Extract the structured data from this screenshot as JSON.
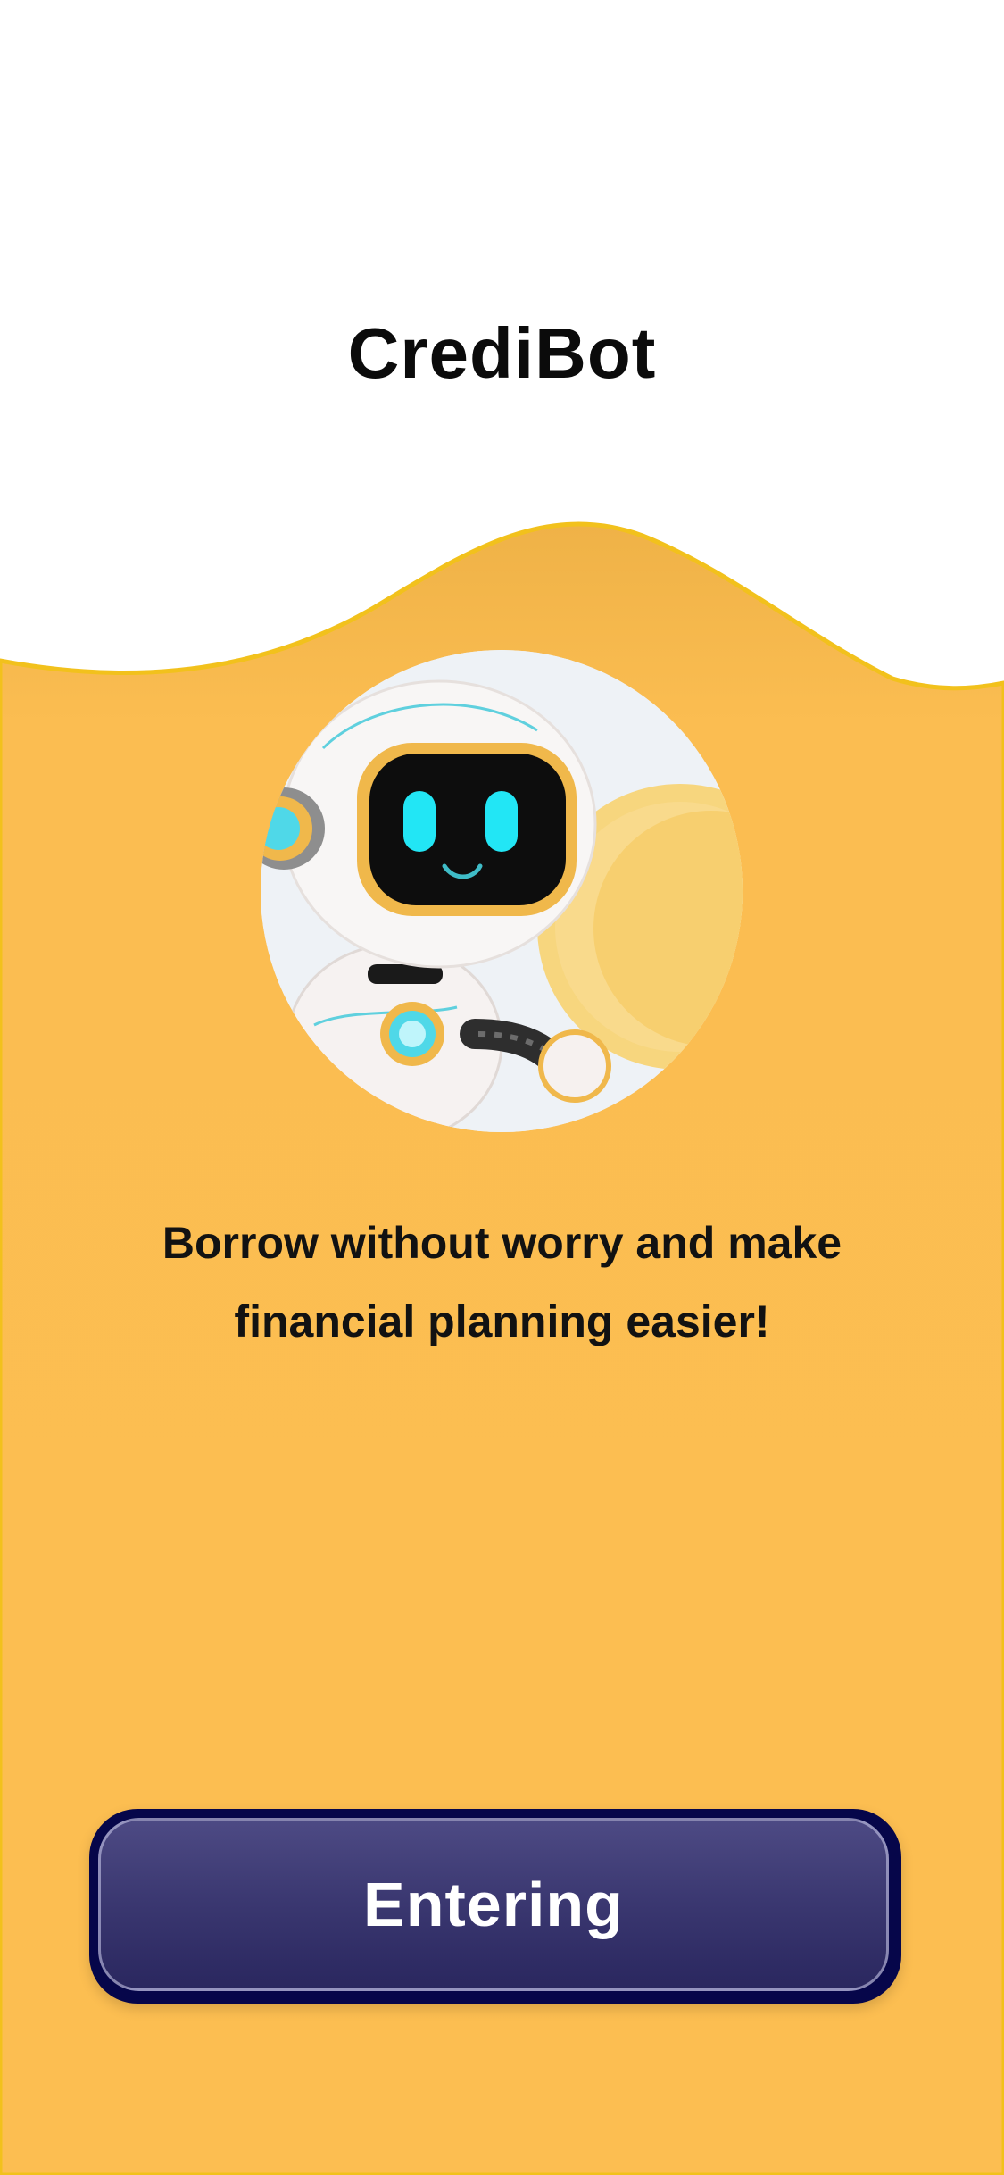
{
  "app": {
    "title": "CrediBot"
  },
  "hero": {
    "image": "robot-holding-coin-illustration"
  },
  "tagline": {
    "line1": "Borrow without worry and make",
    "line2": "financial planning easier!"
  },
  "actions": {
    "enter_label": "Entering"
  },
  "colors": {
    "background_top": "#ffffff",
    "background_main": "#fcbe51",
    "wave_edge": "#f2c11c",
    "button_bg": "#3a3770",
    "button_border": "#06064a",
    "text_dark": "#121212",
    "button_text": "#ffffff"
  }
}
